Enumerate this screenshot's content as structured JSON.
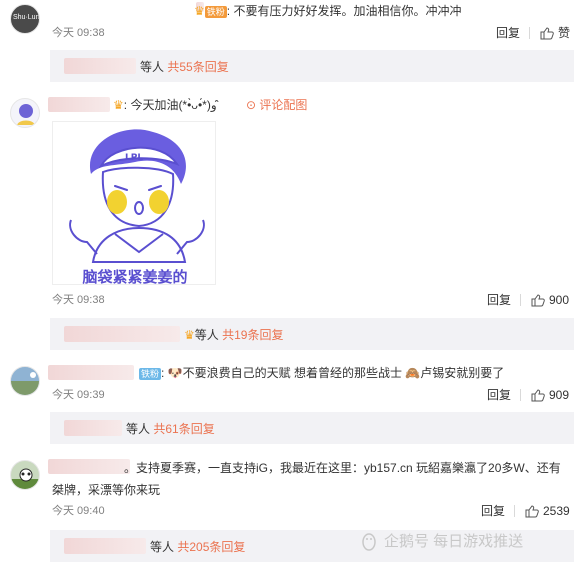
{
  "colors": {
    "link": "#eb7350",
    "reply_bg": "#f2f2f5",
    "muted": "#808080"
  },
  "comments": [
    {
      "badge": "铁粉",
      "text": "不要有压力好好发挥。加油相信你。冲冲冲",
      "time": "今天 09:38",
      "reply_label": "回复",
      "like_label": "赞",
      "sub_reply": {
        "suffix": "等人",
        "link": "共55条回复"
      }
    },
    {
      "text": "今天加油(*•̀ᴗ•́*)و ̑̑",
      "sticker_action": "评论配图",
      "sticker_caption": "脑袋紧紧姜姜的",
      "sticker_cap_text": "LPL",
      "time": "今天 09:38",
      "reply_label": "回复",
      "likes": "900",
      "sub_reply": {
        "suffix": "等人",
        "link": "共19条回复"
      }
    },
    {
      "badge": "铁粉",
      "text": "不要浪费自己的天赋  想着曾经的那些战士",
      "text2": "卢锡安就别要了",
      "time": "今天 09:39",
      "reply_label": "回复",
      "likes": "909",
      "sub_reply": {
        "suffix": "等人",
        "link": "共61条回复"
      }
    },
    {
      "text_line1": "。支持夏季赛，一直支持iG，我最近在这里：yb157.cn 玩紹嘉樂瀛了20多W、还有",
      "text_line2": "桀牌，采漂等你来玩",
      "time": "今天 09:40",
      "reply_label": "回复",
      "likes": "2539",
      "sub_reply": {
        "suffix": "等人",
        "link": "共205条回复"
      }
    }
  ],
  "watermark": "企鹅号 每日游戏推送"
}
